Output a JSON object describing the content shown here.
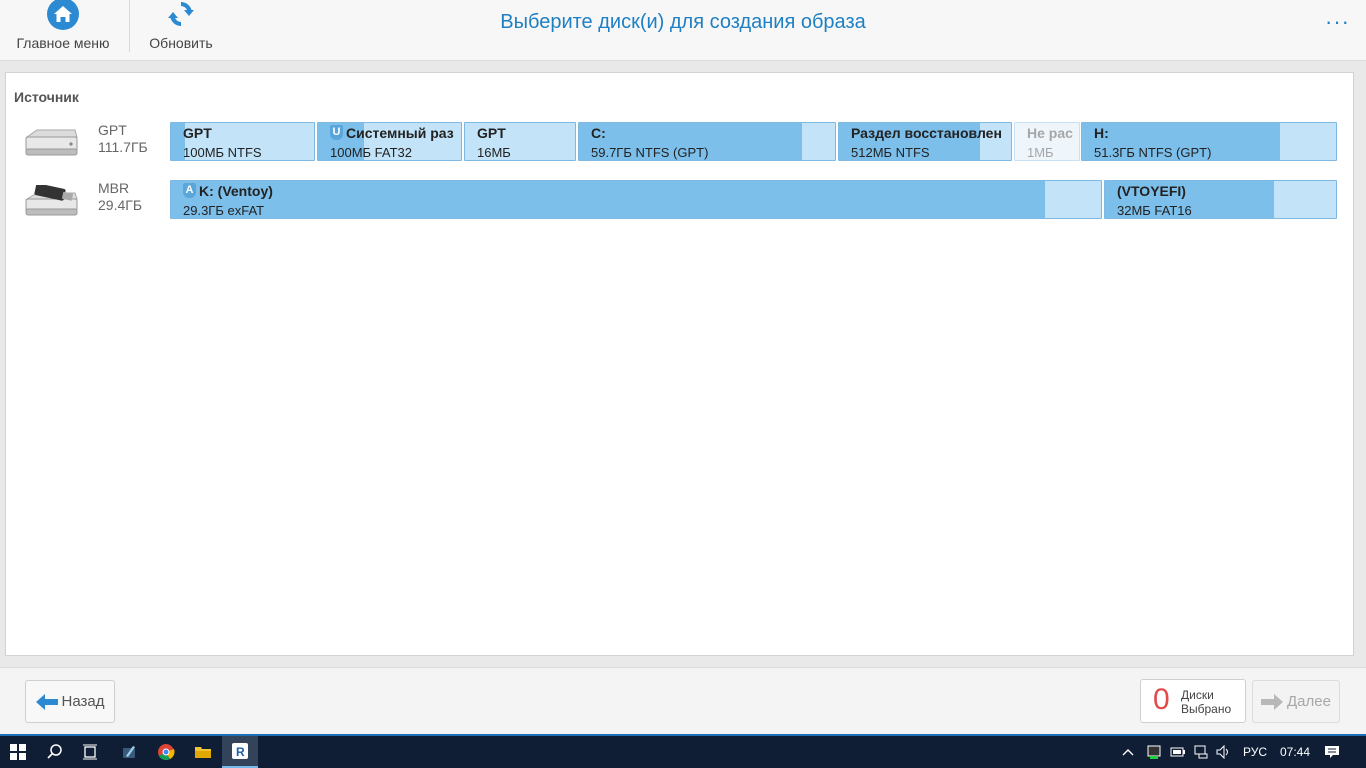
{
  "toolbar": {
    "home_label": "Главное меню",
    "refresh_label": "Обновить",
    "title": "Выберите диск(и) для создания образа",
    "more": "···"
  },
  "source": {
    "label": "Источник",
    "disks": [
      {
        "type": "GPT",
        "size": "111.7ГБ",
        "partitions": [
          {
            "name": "GPT",
            "info": "100МБ NTFS",
            "used_fraction": 0.1
          },
          {
            "name": "Системный раз",
            "badge": "U",
            "info": "100МБ FAT32",
            "used_fraction": 0.32
          },
          {
            "name": "GPT",
            "info": "16МБ",
            "used_fraction": 0.0
          },
          {
            "name": "C:",
            "info": "59.7ГБ NTFS (GPT)",
            "used_fraction": 0.87
          },
          {
            "name": "Раздел восстановлен",
            "info": "512МБ NTFS",
            "used_fraction": 0.82
          },
          {
            "name": "Не рас",
            "info": "1МБ",
            "used_fraction": 0.0,
            "unallocated": true
          },
          {
            "name": "H:",
            "info": "51.3ГБ NTFS (GPT)",
            "used_fraction": 0.78
          }
        ]
      },
      {
        "type": "MBR",
        "size": "29.4ГБ",
        "partitions": [
          {
            "name": "K: (Ventoy)",
            "badge": "A",
            "info": "29.3ГБ exFAT",
            "used_fraction": 0.94
          },
          {
            "name": "(VTOYEFI)",
            "info": "32МБ FAT16",
            "used_fraction": 0.73
          }
        ]
      }
    ]
  },
  "bottom": {
    "back_label": "Назад",
    "selected_count": "0",
    "selected_line1": "Диски",
    "selected_line2": "Выбрано",
    "next_label": "Далее"
  },
  "taskbar": {
    "lang": "РУС",
    "time": "07:44"
  },
  "colors": {
    "accent": "#1e7fc2",
    "partition_used": "#7dbfeb",
    "partition_free": "#c3e4f8",
    "count_red": "#e34a4a"
  }
}
